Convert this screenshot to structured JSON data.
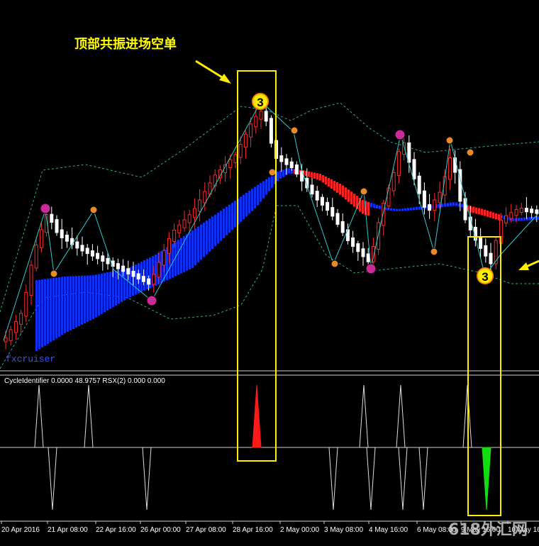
{
  "chart_data": [
    {
      "type": "candlestick",
      "annotation": "顶部共振进场空单",
      "watermark": "fxcruiser",
      "signal_labels": [
        {
          "label": "3",
          "time": "28 Apr 16:00",
          "kind": "top-sell"
        },
        {
          "label": "3",
          "time": "9 May 16:00",
          "kind": "bottom"
        }
      ],
      "colors": {
        "bull": "#ff2a2a",
        "bear": "#ffffff",
        "trend_band": "#1133ff",
        "trend_down": "#ff2222",
        "envelope": "#2fa8a0",
        "zigzag": "#33cccc",
        "marker_orange": "#e88a2a",
        "marker_magenta": "#cc2a99",
        "highlight": "#ffee00"
      }
    },
    {
      "type": "line",
      "indicator_label": "CycleIdentifier 0.0000 48.9757  RSX(2) 0.000 0.000",
      "baseline": 0,
      "ylim": [
        -1,
        1
      ],
      "spikes": [
        {
          "time": "20 Apr 22:00",
          "value": 1
        },
        {
          "time": "21 Apr 04:00",
          "value": -1
        },
        {
          "time": "22 Apr 02:00",
          "value": 1
        },
        {
          "time": "26 Apr 06:00",
          "value": -1
        },
        {
          "time": "28 Apr 20:00",
          "value": 1,
          "color": "#ff1a1a"
        },
        {
          "time": "3 May 06:00",
          "value": -1
        },
        {
          "time": "3 May 22:00",
          "value": 1
        },
        {
          "time": "4 May 04:00",
          "value": -1
        },
        {
          "time": "5 May 02:00",
          "value": 1
        },
        {
          "time": "5 May 08:00",
          "value": -1
        },
        {
          "time": "6 May 02:00",
          "value": -1
        },
        {
          "time": "9 May 06:00",
          "value": 1
        },
        {
          "time": "9 May 16:00",
          "value": -1,
          "color": "#11dd11"
        }
      ],
      "x_tick_labels": [
        "20 Apr 2016",
        "21 Apr 08:00",
        "22 Apr 16:00",
        "26 Apr 00:00",
        "27 Apr 08:00",
        "28 Apr 16:00",
        "2 May 00:00",
        "3 May 08:00",
        "4 May 16:00",
        "6 May 08:00",
        "9 May 16:00",
        "10 May 16"
      ]
    }
  ],
  "logo_text": "618外汇网"
}
